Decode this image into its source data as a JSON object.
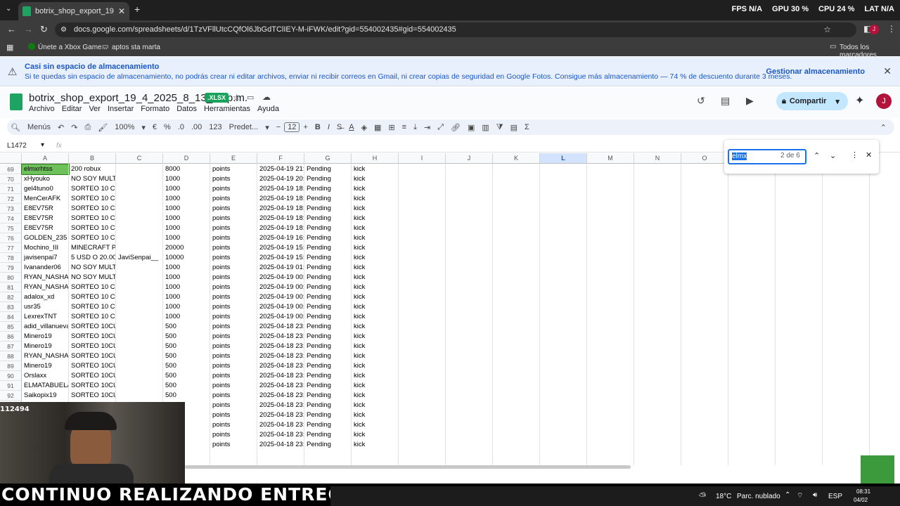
{
  "browser": {
    "tab_title": "botrix_shop_export_19_4_2025...",
    "url": "docs.google.com/spreadsheets/d/1TzVFllUtcCQfOl6JbGdTClIEY-M-iFWK/edit?gid=554002435#gid=554002435",
    "stats": {
      "fps_label": "FPS",
      "fps_value": "N/A",
      "gpu_label": "GPU",
      "gpu_value": "30 %",
      "cpu_label": "CPU",
      "cpu_value": "24 %",
      "lat_label": "LAT",
      "lat_value": "N/A"
    },
    "bookmarks": [
      "Únete a Xbox Game...",
      "aptos sta marta"
    ],
    "all_bookmarks": "Todos los marcadores"
  },
  "banner": {
    "title": "Casi sin espacio de almacenamiento",
    "message": "Si te quedas sin espacio de almacenamiento, no podrás crear ni editar archivos, enviar ni recibir correos en Gmail, ni crear copias de seguridad en Google Fotos. Consigue más almacenamiento — 74 % de descuento durante 3 meses.",
    "manage": "Gestionar almacenamiento"
  },
  "doc": {
    "title": "botrix_shop_export_19_4_2025_8_13_17 p.m.",
    "badge": ".XLSX",
    "menus": [
      "Archivo",
      "Editar",
      "Ver",
      "Insertar",
      "Formato",
      "Datos",
      "Herramientas",
      "Ayuda"
    ],
    "share": "Compartir",
    "avatar": "J"
  },
  "toolbar": {
    "menus": "Menús",
    "zoom": "100%",
    "currency": "€",
    "percent": "%",
    "dec_less": ".0",
    "dec_more": ".00",
    "format_num": "123",
    "font": "Predet...",
    "font_size": "12",
    "bold": "B",
    "italic": "I"
  },
  "formula": {
    "cell_ref": "L1472",
    "fx": "fx"
  },
  "find": {
    "query": "elmx",
    "count": "2 de 6"
  },
  "columns": [
    "A",
    "B",
    "C",
    "D",
    "E",
    "F",
    "G",
    "H",
    "I",
    "J",
    "K",
    "L",
    "M",
    "N",
    "O",
    "P",
    "Q",
    "R"
  ],
  "rows": [
    {
      "n": "69",
      "a": "elmxrhtss",
      "b": "200 robux",
      "c": "",
      "d": "8000",
      "e": "points",
      "f": "2025-04-19 21:",
      "g": "Pending",
      "h": "kick"
    },
    {
      "n": "70",
      "a": "xHyouko",
      "b": "NO SOY MULTICUENTA",
      "c": "",
      "d": "1000",
      "e": "points",
      "f": "2025-04-19 20:",
      "g": "Pending",
      "h": "kick"
    },
    {
      "n": "71",
      "a": "gel4tuno0",
      "b": "SORTEO 10 CUENTAS DE MC P/",
      "c": "",
      "d": "1000",
      "e": "points",
      "f": "2025-04-19 18:",
      "g": "Pending",
      "h": "kick"
    },
    {
      "n": "72",
      "a": "MenCerAFK",
      "b": "SORTEO 10 CUENTAS DE MC P/",
      "c": "",
      "d": "1000",
      "e": "points",
      "f": "2025-04-19 18:",
      "g": "Pending",
      "h": "kick"
    },
    {
      "n": "73",
      "a": "E8EV75R",
      "b": "SORTEO 10 CUENTAS DE MC P/",
      "c": "",
      "d": "1000",
      "e": "points",
      "f": "2025-04-19 18:",
      "g": "Pending",
      "h": "kick"
    },
    {
      "n": "74",
      "a": "E8EV75R",
      "b": "SORTEO 10 CUENTAS DE MC P/",
      "c": "",
      "d": "1000",
      "e": "points",
      "f": "2025-04-19 18:",
      "g": "Pending",
      "h": "kick"
    },
    {
      "n": "75",
      "a": "E8EV75R",
      "b": "SORTEO 10 CUENTAS DE MC P/",
      "c": "",
      "d": "1000",
      "e": "points",
      "f": "2025-04-19 18:",
      "g": "Pending",
      "h": "kick"
    },
    {
      "n": "76",
      "a": "GOLDEN_235",
      "b": "SORTEO 10 CUENTAS DE MC P/",
      "c": "",
      "d": "1000",
      "e": "points",
      "f": "2025-04-19 16:",
      "g": "Pending",
      "h": "kick"
    },
    {
      "n": "77",
      "a": "Mochino_III",
      "b": "MINECRAFT PE Discord: mochi",
      "c": "",
      "d": "20000",
      "e": "points",
      "f": "2025-04-19 15:",
      "g": "Pending",
      "h": "kick"
    },
    {
      "n": "78",
      "a": "javisenpai7",
      "b": "5 USD O 20.00(",
      "c": "JaviSenpai__",
      "d": "10000",
      "e": "points",
      "f": "2025-04-19 15:",
      "g": "Pending",
      "h": "kick"
    },
    {
      "n": "79",
      "a": "Ivanander06",
      "b": "NO SOY MULTICUENTA",
      "c": "",
      "d": "1000",
      "e": "points",
      "f": "2025-04-19 01:",
      "g": "Pending",
      "h": "kick"
    },
    {
      "n": "80",
      "a": "RYAN_NASHAV",
      "b": "NO SOY MULTICUENTA",
      "c": "",
      "d": "1000",
      "e": "points",
      "f": "2025-04-19 00:",
      "g": "Pending",
      "h": "kick"
    },
    {
      "n": "81",
      "a": "RYAN_NASHAV",
      "b": "SORTEO 10 CUENTAS DE MC P/",
      "c": "",
      "d": "1000",
      "e": "points",
      "f": "2025-04-19 00:",
      "g": "Pending",
      "h": "kick"
    },
    {
      "n": "82",
      "a": "adalox_xd",
      "b": "SORTEO 10 CUENTAS DE MC P/",
      "c": "",
      "d": "1000",
      "e": "points",
      "f": "2025-04-19 00:",
      "g": "Pending",
      "h": "kick"
    },
    {
      "n": "83",
      "a": "usr35",
      "b": "SORTEO 10 CUENTAS DE MC P/",
      "c": "",
      "d": "1000",
      "e": "points",
      "f": "2025-04-19 00:",
      "g": "Pending",
      "h": "kick"
    },
    {
      "n": "84",
      "a": "LexrexTNT",
      "b": "SORTEO 10 CUENTAS DE MC P/",
      "c": "",
      "d": "1000",
      "e": "points",
      "f": "2025-04-19 00:",
      "g": "Pending",
      "h": "kick"
    },
    {
      "n": "85",
      "a": "adid_villanueva",
      "b": "SORTEO 10CUENTAS DE MINEC",
      "c": "",
      "d": "500",
      "e": "points",
      "f": "2025-04-18 23:",
      "g": "Pending",
      "h": "kick"
    },
    {
      "n": "86",
      "a": "Minero19",
      "b": "SORTEO 10CUENTAS DE MINEC",
      "c": "",
      "d": "500",
      "e": "points",
      "f": "2025-04-18 23:",
      "g": "Pending",
      "h": "kick"
    },
    {
      "n": "87",
      "a": "Minero19",
      "b": "SORTEO 10CUENTAS DE MINEC",
      "c": "",
      "d": "500",
      "e": "points",
      "f": "2025-04-18 23:",
      "g": "Pending",
      "h": "kick"
    },
    {
      "n": "88",
      "a": "RYAN_NASHAV",
      "b": "SORTEO 10CUENTAS DE MINEC",
      "c": "",
      "d": "500",
      "e": "points",
      "f": "2025-04-18 23:",
      "g": "Pending",
      "h": "kick"
    },
    {
      "n": "89",
      "a": "Minero19",
      "b": "SORTEO 10CUENTAS DE MINEC",
      "c": "",
      "d": "500",
      "e": "points",
      "f": "2025-04-18 23:",
      "g": "Pending",
      "h": "kick"
    },
    {
      "n": "90",
      "a": "Orslaxx",
      "b": "SORTEO 10CUENTAS DE MINEC",
      "c": "",
      "d": "500",
      "e": "points",
      "f": "2025-04-18 23:",
      "g": "Pending",
      "h": "kick"
    },
    {
      "n": "91",
      "a": "ELMATABUELAS",
      "b": "SORTEO 10CUENTAS DE MINEC",
      "c": "",
      "d": "500",
      "e": "points",
      "f": "2025-04-18 23:",
      "g": "Pending",
      "h": "kick"
    },
    {
      "n": "92",
      "a": "Saikopix19",
      "b": "SORTEO 10CUENTAS DE MINEC",
      "c": "",
      "d": "500",
      "e": "points",
      "f": "2025-04-18 23:",
      "g": "Pending",
      "h": "kick"
    },
    {
      "n": "",
      "a": "",
      "b": "",
      "c": "",
      "d": "",
      "e": "points",
      "f": "2025-04-18 23:",
      "g": "Pending",
      "h": "kick"
    },
    {
      "n": "",
      "a": "",
      "b": "",
      "c": "",
      "d": "",
      "e": "points",
      "f": "2025-04-18 23:",
      "g": "Pending",
      "h": "kick"
    },
    {
      "n": "",
      "a": "",
      "b": "",
      "c": "",
      "d": "",
      "e": "points",
      "f": "2025-04-18 23:",
      "g": "Pending",
      "h": "kick"
    },
    {
      "n": "",
      "a": "",
      "b": "",
      "c": "",
      "d": "",
      "e": "points",
      "f": "2025-04-18 23:",
      "g": "Pending",
      "h": "kick"
    },
    {
      "n": "",
      "a": "",
      "b": "",
      "c": "",
      "d": "",
      "e": "points",
      "f": "2025-04-18 23:",
      "g": "Pending",
      "h": "kick"
    }
  ],
  "overlay": {
    "viewer_count": "112494",
    "caption": "CONTINUO REALIZANDO ENTREGAS"
  },
  "taskbar": {
    "weather": "18°C",
    "weather_desc": "Parc. nublado",
    "lang": "ESP",
    "time": "08:31",
    "date": "04/02"
  },
  "colors": {
    "accent": "#1a73e8",
    "match_highlight": "#6ec05a",
    "sheets_green": "#1ea362"
  }
}
